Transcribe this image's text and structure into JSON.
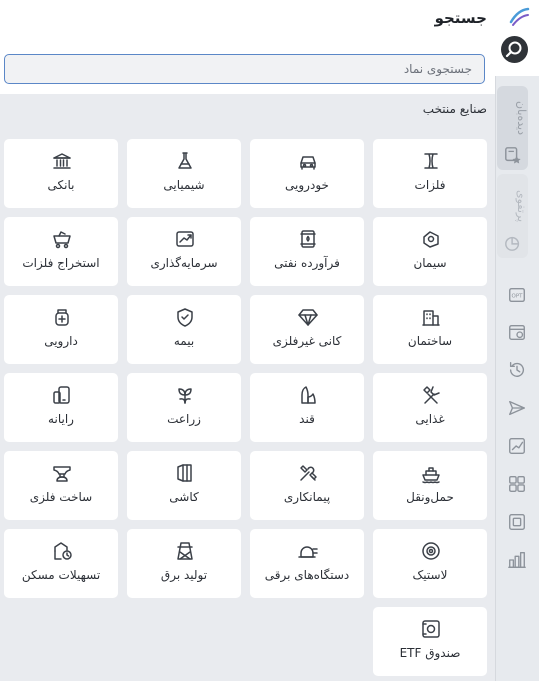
{
  "header": {
    "title": "جستجو"
  },
  "search": {
    "placeholder": "جستجوی نماد"
  },
  "section": {
    "label": "صنایع منتخب"
  },
  "categories": [
    {
      "label": "فلزات",
      "icon": "ibeam-icon"
    },
    {
      "label": "خودرویی",
      "icon": "car-icon"
    },
    {
      "label": "شیمیایی",
      "icon": "flask-icon"
    },
    {
      "label": "بانکی",
      "icon": "bank-icon"
    },
    {
      "label": "سیمان",
      "icon": "cement-icon"
    },
    {
      "label": "فرآورده نفتی",
      "icon": "oil-barrel-icon"
    },
    {
      "label": "سرمایه‌گذاری",
      "icon": "investment-chart-icon"
    },
    {
      "label": "استخراج فلزات",
      "icon": "mine-cart-icon"
    },
    {
      "label": "ساختمان",
      "icon": "building-icon"
    },
    {
      "label": "کانی غیرفلزی",
      "icon": "diamond-icon"
    },
    {
      "label": "بیمه",
      "icon": "shield-check-icon"
    },
    {
      "label": "دارویی",
      "icon": "medicine-icon"
    },
    {
      "label": "غذایی",
      "icon": "utensils-icon"
    },
    {
      "label": "قند",
      "icon": "sugar-icon"
    },
    {
      "label": "زراعت",
      "icon": "plant-icon"
    },
    {
      "label": "رایانه",
      "icon": "devices-icon"
    },
    {
      "label": "حمل‌ونقل",
      "icon": "ship-icon"
    },
    {
      "label": "پیمانکاری",
      "icon": "tools-icon"
    },
    {
      "label": "کاشی",
      "icon": "tiles-icon"
    },
    {
      "label": "ساخت فلزی",
      "icon": "anvil-icon"
    },
    {
      "label": "لاستیک",
      "icon": "tire-icon"
    },
    {
      "label": "دستگاه‌های برقی",
      "icon": "plug-icon"
    },
    {
      "label": "تولید برق",
      "icon": "power-tower-icon"
    },
    {
      "label": "تسهیلات مسکن",
      "icon": "house-loan-icon"
    },
    {
      "label": "صندوق ETF",
      "icon": "etf-safe-icon"
    }
  ],
  "rail": {
    "tabs": [
      {
        "label": "دیده‌بان",
        "icon": "watchlist-icon"
      },
      {
        "label": "پرتفوی",
        "icon": "portfolio-icon"
      }
    ],
    "icons": [
      "opt-icon",
      "calendar-icon",
      "history-icon",
      "send-icon",
      "chart-icon",
      "apps-icon",
      "box-icon",
      "bar-chart-icon"
    ]
  },
  "colors": {
    "accent": "#5b87c7",
    "background": "#e9ebef",
    "rail": "#e7eaee"
  }
}
